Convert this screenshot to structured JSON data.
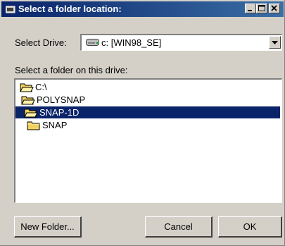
{
  "window": {
    "title": "Select a folder location:"
  },
  "drive": {
    "label": "Select Drive:",
    "value": "c: [WIN98_SE]",
    "icon": "drive-icon"
  },
  "folders": {
    "label": "Select a folder on this drive:",
    "items": [
      {
        "label": "C:\\",
        "icon": "folder-open-icon",
        "selected": false
      },
      {
        "label": "POLYSNAP",
        "icon": "folder-open-icon",
        "selected": false
      },
      {
        "label": "SNAP-1D",
        "icon": "folder-open-icon",
        "selected": true
      },
      {
        "label": "SNAP",
        "icon": "folder-icon",
        "selected": false
      }
    ]
  },
  "buttons": {
    "new_folder": "New Folder...",
    "cancel": "Cancel",
    "ok": "OK"
  },
  "colors": {
    "title_bar": "#0a246a",
    "selection": "#0a246a",
    "folder": "#f0d060"
  }
}
